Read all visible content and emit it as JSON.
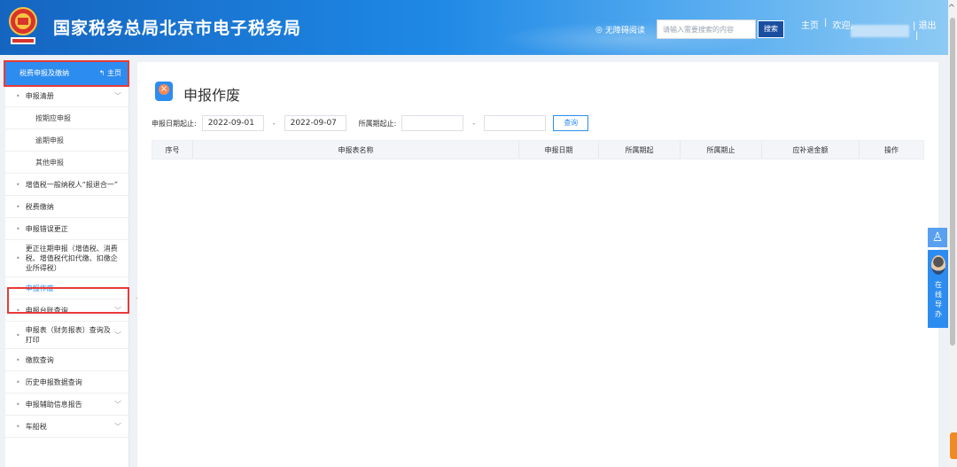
{
  "header": {
    "site_title": "国家税务总局北京市电子税务局",
    "accessibility_label": "无障碍阅读",
    "search_placeholder": "请输入需要搜索的内容",
    "search_button": "搜索",
    "home_link": "主页",
    "separator": "|",
    "welcome": "欢迎,",
    "logout": "退出",
    "logout_bar": "|"
  },
  "sidebar": {
    "header_label": "税费申报及缴纳",
    "home_label": "主页",
    "items": [
      {
        "label": "申报清册",
        "chevron": true
      },
      {
        "label": "按期应申报",
        "sub": true
      },
      {
        "label": "逾期申报",
        "sub": true
      },
      {
        "label": "其他申报",
        "sub": true
      },
      {
        "label": "增值税一般纳税人“报退合一”",
        "chevron": false
      },
      {
        "label": "税费缴纳",
        "chevron": false
      },
      {
        "label": "申报错误更正",
        "chevron": false
      },
      {
        "label": "更正往期申报（增值税、消费税、增值税代扣代缴、扣缴企业所得税）",
        "chevron": false
      },
      {
        "label": "申报作废",
        "chevron": false,
        "active": true
      },
      {
        "label": "申报台账查询",
        "chevron": true
      },
      {
        "label": "申报表（财务报表）查询及打印",
        "chevron": true
      },
      {
        "label": "缴款查询",
        "chevron": false
      },
      {
        "label": "历史申报数据查询",
        "chevron": false
      },
      {
        "label": "申报辅助信息报告",
        "chevron": true
      },
      {
        "label": "车船税",
        "chevron": true
      }
    ]
  },
  "main": {
    "page_title": "申报作废",
    "filter": {
      "declare_date_label": "申报日期起止:",
      "date_start": "2022-09-01",
      "dash": "-",
      "date_end": "2022-09-07",
      "period_label": "所属期起止:",
      "period_start": "",
      "period_end": "",
      "query_button": "查询"
    },
    "table_columns": [
      "序号",
      "申报表名称",
      "申报日期",
      "所属期起",
      "所属期止",
      "应补退金额",
      "操作"
    ]
  },
  "float_widget": {
    "guide_label": "在线导办"
  },
  "colors": {
    "accent": "#2d8cf0",
    "highlight": "#e83a3a"
  }
}
